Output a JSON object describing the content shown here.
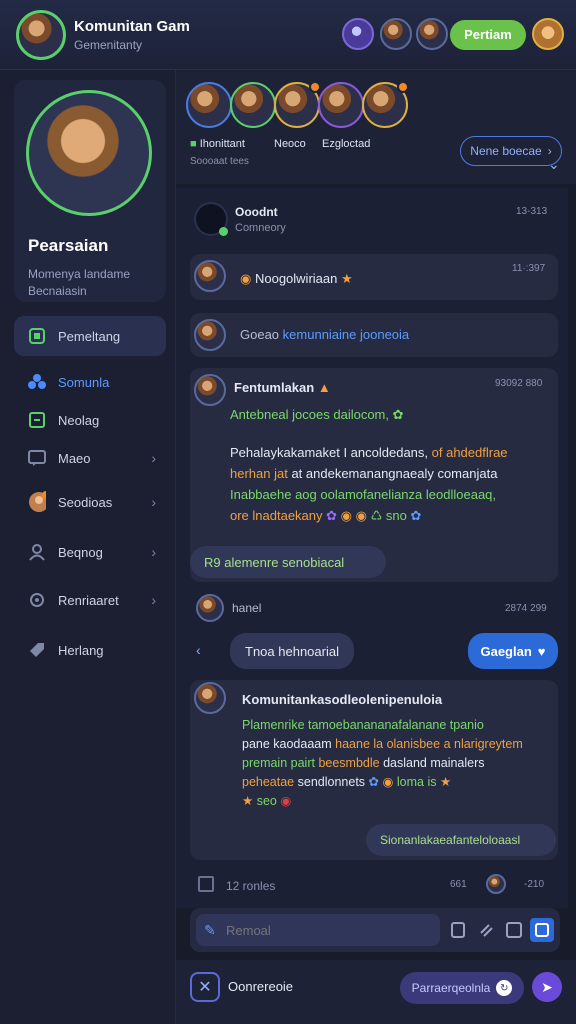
{
  "header": {
    "title": "Komunitan Gam",
    "subtitle": "Gemenitanty",
    "join_label": "Pertiam"
  },
  "sidebar": {
    "profile": {
      "name": "Pearsaian",
      "description": "Momenya landame Becnaiasin"
    },
    "items": [
      {
        "label": "Pemeltang",
        "icon": "home-icon",
        "active": true,
        "chevron": false
      },
      {
        "label": "Somunla",
        "icon": "community-icon",
        "active": false,
        "chevron": false
      },
      {
        "label": "Neolag",
        "icon": "game-icon",
        "active": false,
        "chevron": false
      },
      {
        "label": "Maeo",
        "icon": "message-icon",
        "active": false,
        "chevron": true
      },
      {
        "label": "Seodioas",
        "icon": "friends-icon",
        "active": false,
        "chevron": true
      },
      {
        "label": "Beqnog",
        "icon": "user-icon",
        "active": false,
        "chevron": true
      },
      {
        "label": "Renriaaret",
        "icon": "settings-icon",
        "active": false,
        "chevron": true
      },
      {
        "label": "Herlang",
        "icon": "tag-icon",
        "active": false,
        "chevron": false
      }
    ]
  },
  "stories": {
    "labels": [
      "Ihonittant",
      "Neoco",
      "Ezgloctad"
    ],
    "sub": "Soooaat tees",
    "more_label": "Nene boecae"
  },
  "feed": {
    "header": {
      "name": "Ooodnt",
      "sub": "Comneory",
      "time": "13-313"
    },
    "post1": {
      "text": "Noogolwiriaan",
      "time": "11·:397"
    },
    "post2": {
      "text_a": "Goeao",
      "text_b": "kemunniaine jooneoia"
    },
    "post3": {
      "title": "Fentumlakan",
      "time": "93092 880",
      "line1": "Antebneal jocoes dailocom,",
      "p1": "Pehalaykakamaket I ancoldedans,",
      "p1b": "of ahdedflrae",
      "p2": "herhan jat",
      "p2b": "at andekemanangnaealy comanjata",
      "p3": "Inabbaehe aog oolamofanelianza",
      "p3b": "leodlloeaaq,",
      "p4": "ore lnadtaekany",
      "p4b": "sno",
      "reply": "R9 alemenre senobiacal"
    },
    "post4": {
      "name": "hanel",
      "time": "2874 299"
    },
    "action_row": {
      "chip": "Tnoa hehnoarial",
      "button": "Gaeglan"
    },
    "post5": {
      "title": "Komunitankasodleolenipenuloia",
      "l1": "Plamenrike tamoebanananafalanane tpanio",
      "l2a": "pane kaodaaam",
      "l2b": "haane la olanisbee a nlarigreytem",
      "l3a": "premain pairt",
      "l3b": "beesmbdle",
      "l3c": "dasland mainalers",
      "l4a": "peheatae",
      "l4b": "sendlonnets",
      "l4c": "loma is",
      "l5": "seo",
      "reply": "Sionanlakaeafanteloloaasl"
    },
    "meta": {
      "count": "12 ronles",
      "a": "661",
      "b": "-210"
    }
  },
  "composer": {
    "placeholder": "Remoal"
  },
  "bottom": {
    "left_label": "Oonrereoie",
    "right_label": "Parraerqeolnla"
  },
  "colors": {
    "accent_green": "#6ac24a",
    "accent_blue": "#2c6ad8",
    "accent_purple": "#6a4ad8"
  }
}
